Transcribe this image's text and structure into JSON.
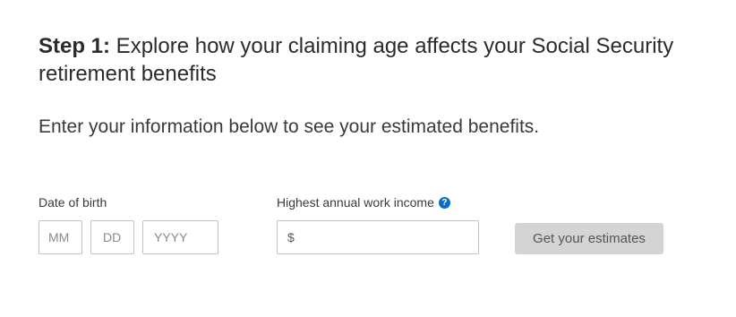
{
  "heading": {
    "step_label": "Step 1:",
    "text": " Explore how your claiming age affects your Social Security retirement benefits"
  },
  "intro": "Enter your information below to see your estimated benefits.",
  "dob": {
    "label": "Date of birth",
    "month_placeholder": "MM",
    "day_placeholder": "DD",
    "year_placeholder": "YYYY"
  },
  "income": {
    "label": "Highest annual work income",
    "help_icon": "question-circle-icon",
    "help_glyph": "?",
    "currency_symbol": "$",
    "value": ""
  },
  "submit": {
    "label": "Get your estimates"
  },
  "colors": {
    "help_icon": "#0a6cc2",
    "button_bg": "#d4d4d4",
    "button_text": "#555555",
    "field_border": "#c3c3c3"
  }
}
